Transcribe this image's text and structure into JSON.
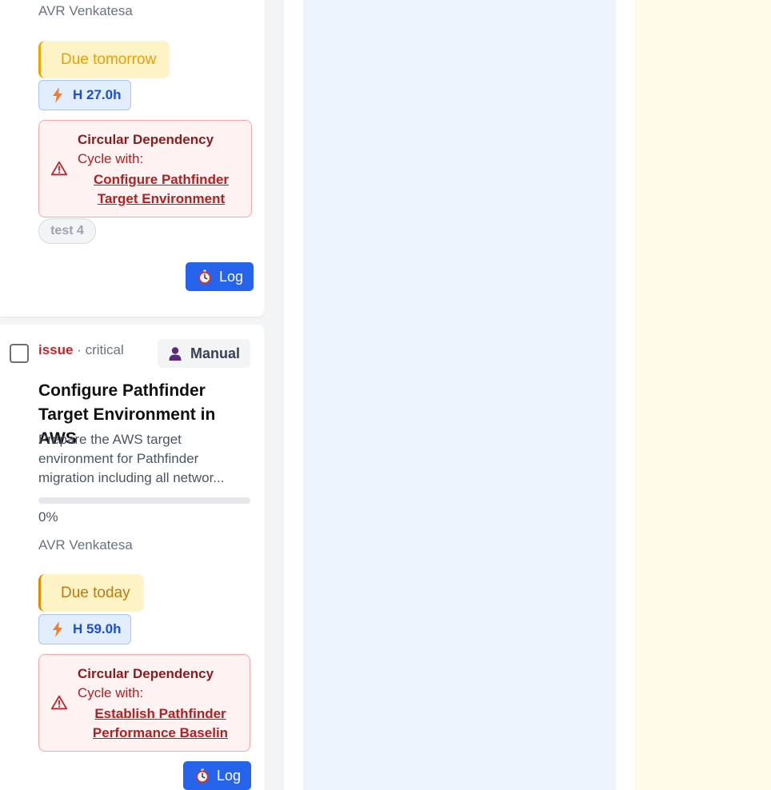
{
  "columns": {
    "blue_bg": "#eef4fe",
    "yellow_bg": "#fffbe8"
  },
  "card_top": {
    "assignee": "AVR Venkatesa",
    "due_label": "Due tomorrow",
    "estimate": "H 27.0h",
    "dependency": {
      "title": "Circular Dependency",
      "cycle_label": "Cycle with:",
      "link_text": "Configure Pathfinder Target Environment"
    },
    "tag": "test 4",
    "log_label": "Log"
  },
  "card_bottom": {
    "type": "issue",
    "separator": " · ",
    "priority": "critical",
    "mode_label": "Manual",
    "title": "Configure Pathfinder Target Environment in AWS",
    "description": "Prepare the AWS target environment for Pathfinder migration including all networ...",
    "progress": 0,
    "progress_label": "0%",
    "assignee": "AVR Venkatesa",
    "due_label": "Due today",
    "estimate": "H 59.0h",
    "dependency": {
      "title": "Circular Dependency",
      "cycle_label": "Cycle with:",
      "link_text": "Establish Pathfinder Performance Baselin"
    },
    "log_label": "Log"
  },
  "colors": {
    "accent": "#2563eb",
    "danger": "#b42020",
    "warning": "#f0a400"
  },
  "icons": [
    "bolt-icon",
    "warning-icon",
    "stopwatch-icon",
    "user-icon"
  ]
}
